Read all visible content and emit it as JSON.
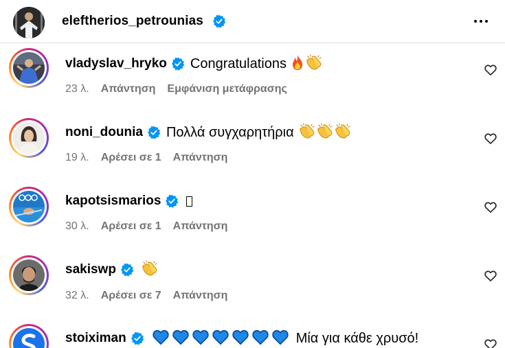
{
  "header": {
    "username": "eleftherios_petrounias",
    "verified_icon": "verified-badge-icon",
    "more_icon": "more-options-icon"
  },
  "colors": {
    "verified": "#0095f6",
    "secondary_text": "#737373",
    "story_ring": "#d62976"
  },
  "comments": [
    {
      "username": "vladyslav_hryko",
      "text": "Congratulations",
      "emojis": [
        "fire-emoji",
        "clapping-hands-emoji"
      ],
      "time": "23 λ.",
      "actions": [
        "Απάντηση",
        "Εμφάνιση μετάφρασης"
      ]
    },
    {
      "username": "noni_dounia",
      "text": "Πολλά συγχαρητήρια",
      "emojis": [
        "clapping-hands-emoji",
        "clapping-hands-emoji",
        "clapping-hands-emoji"
      ],
      "time": "19 λ.",
      "actions": [
        "Αρέσει σε 1",
        "Απάντηση"
      ]
    },
    {
      "username": "kapotsismarios",
      "text": "",
      "emojis": [
        "missing-glyph-box"
      ],
      "time": "30 λ.",
      "actions": [
        "Αρέσει σε 1",
        "Απάντηση"
      ]
    },
    {
      "username": "sakiswp",
      "text": "",
      "emojis": [
        "clapping-hands-emoji"
      ],
      "time": "32 λ.",
      "actions": [
        "Αρέσει σε 7",
        "Απάντηση"
      ]
    },
    {
      "username": "stoiximan",
      "text": "Μία για κάθε χρυσό!",
      "emojis": [
        "blue-heart-emoji",
        "blue-heart-emoji",
        "blue-heart-emoji",
        "blue-heart-emoji",
        "blue-heart-emoji",
        "blue-heart-emoji",
        "blue-heart-emoji"
      ],
      "time": "",
      "actions": []
    }
  ],
  "like_icon": "heart-outline-icon"
}
